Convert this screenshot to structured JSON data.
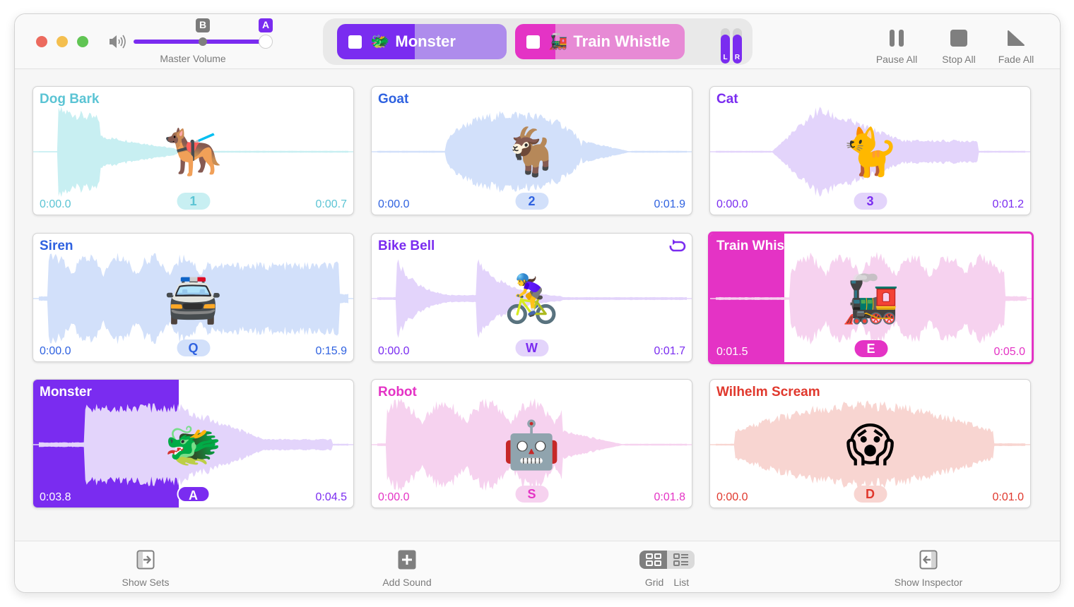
{
  "window": {
    "traffic_lights": [
      "close",
      "minimize",
      "zoom"
    ]
  },
  "toolbar": {
    "master_volume": {
      "label": "Master Volume",
      "icon": "speaker-icon",
      "marker_b": "B",
      "marker_a": "A",
      "value_b": 0.52,
      "value_a": 1.0
    },
    "now_playing": [
      {
        "name": "Monster",
        "emoji": "🐲",
        "progress": 0.45,
        "color": "#7a2cf0",
        "light": "#ae8cec"
      },
      {
        "name": "Train Whistle",
        "emoji": "🚂",
        "progress": 0.24,
        "color": "#e433c5",
        "light": "#e78ad5"
      }
    ],
    "meters": {
      "left": {
        "label": "L",
        "level": 0.82
      },
      "right": {
        "label": "R",
        "level": 0.82
      }
    },
    "buttons": {
      "pause_all": "Pause All",
      "stop_all": "Stop All",
      "fade_all": "Fade All"
    }
  },
  "sounds": [
    {
      "name": "Dog Bark",
      "emoji": "🐕‍🦺",
      "key": "1",
      "start": "0:00.0",
      "end": "0:00.7",
      "color": "#5bc4d4",
      "wave": "#c8eff2",
      "keybg": "#c8eff2",
      "progress": 0,
      "shape": "dog",
      "loop": false,
      "selected": false
    },
    {
      "name": "Goat",
      "emoji": "🐐",
      "key": "2",
      "start": "0:00.0",
      "end": "0:01.9",
      "color": "#2f62e0",
      "wave": "#d2e0fa",
      "keybg": "#d2e0fa",
      "progress": 0,
      "shape": "goat",
      "loop": false,
      "selected": false
    },
    {
      "name": "Cat",
      "emoji": "🐈",
      "key": "3",
      "start": "0:00.0",
      "end": "0:01.2",
      "color": "#7a2cf0",
      "wave": "#e3d4fb",
      "keybg": "#e3d4fb",
      "progress": 0,
      "shape": "cat",
      "loop": false,
      "selected": false
    },
    {
      "name": "Siren",
      "emoji": "🚔",
      "key": "Q",
      "start": "0:00.0",
      "end": "0:15.9",
      "color": "#2f62e0",
      "wave": "#d2e0fa",
      "keybg": "#d2e0fa",
      "progress": 0,
      "shape": "siren",
      "loop": false,
      "selected": false
    },
    {
      "name": "Bike Bell",
      "emoji": "🚴‍♀️",
      "key": "W",
      "start": "0:00.0",
      "end": "0:01.7",
      "color": "#7a2cf0",
      "wave": "#e3d4fb",
      "keybg": "#e3d4fb",
      "progress": 0,
      "shape": "bell",
      "loop": true,
      "selected": false
    },
    {
      "name": "Train Whistle",
      "emoji": "🚂",
      "key": "E",
      "start": "0:01.5",
      "end": "0:05.0",
      "color": "#e433c5",
      "wave": "#f6d2ef",
      "keybg": "#e433c5",
      "progress": 0.23,
      "shape": "train",
      "loop": false,
      "selected": true
    },
    {
      "name": "Monster",
      "emoji": "🐲",
      "key": "A",
      "start": "0:03.8",
      "end": "0:04.5",
      "color": "#7a2cf0",
      "wave": "#e3d4fb",
      "keybg": "#7a2cf0",
      "progress": 0.455,
      "shape": "monster",
      "loop": false,
      "selected": false
    },
    {
      "name": "Robot",
      "emoji": "🤖",
      "key": "S",
      "start": "0:00.0",
      "end": "0:01.8",
      "color": "#e433c5",
      "wave": "#f6d2ef",
      "keybg": "#f6d2ef",
      "progress": 0,
      "shape": "robot",
      "loop": false,
      "selected": false
    },
    {
      "name": "Wilhelm Scream",
      "emoji": "😱",
      "key": "D",
      "start": "0:00.0",
      "end": "0:01.0",
      "color": "#e0382d",
      "wave": "#f8d5d1",
      "keybg": "#f8d5d1",
      "progress": 0,
      "shape": "scream",
      "loop": false,
      "selected": false
    }
  ],
  "bottombar": {
    "show_sets": "Show Sets",
    "add_sound": "Add Sound",
    "grid": "Grid",
    "list": "List",
    "view_selected": "Grid",
    "show_inspector": "Show Inspector"
  }
}
